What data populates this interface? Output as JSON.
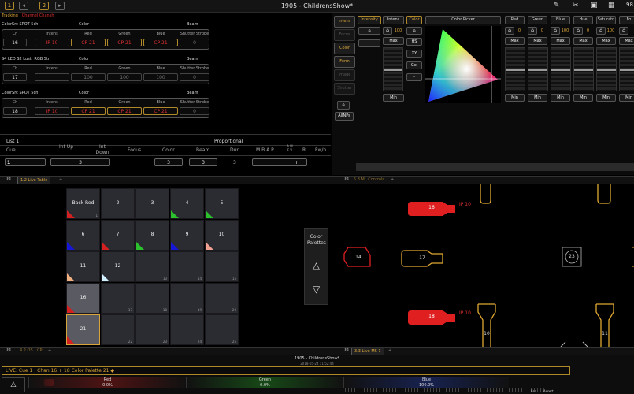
{
  "window": {
    "title": "1905 - ChildrensShow*",
    "tab1": "1",
    "tab2": "2",
    "right_num": "98"
  },
  "channels": {
    "mode": "Tracking",
    "mode_sep": " | ",
    "mode2": "Channel Chansh",
    "groups": [
      {
        "type": "ColorSrc SPOT 5ch",
        "cat_color": "Color",
        "cat_beam": "Beam",
        "headers": [
          "Ch",
          "Intens",
          "Red",
          "Green",
          "Blue",
          "Shutter Strobe"
        ],
        "values": [
          "16",
          "IP 10",
          "CP 21",
          "CP 21",
          "CP 21",
          "0"
        ]
      },
      {
        "type": "S4 LED S2 Lustr RGB Str",
        "cat_color": "Color",
        "cat_beam": "Beam",
        "headers": [
          "Ch",
          "Intens",
          "Red",
          "Green",
          "Blue",
          "Shutter Strobe"
        ],
        "values": [
          "17",
          "",
          "100",
          "100",
          "100",
          "0"
        ]
      },
      {
        "type": "ColorSrc SPOT 5ch",
        "cat_color": "Color",
        "cat_beam": "Beam",
        "headers": [
          "Ch",
          "Intens",
          "Red",
          "Green",
          "Blue",
          "Shutter Strobe"
        ],
        "values": [
          "18",
          "IP 10",
          "CP 21",
          "CP 21",
          "CP 21",
          "0"
        ]
      }
    ]
  },
  "cue": {
    "list": "List 1",
    "proportional": "Proportional",
    "headers": [
      "Cue",
      "Int Up",
      "Int Down",
      "Focus",
      "Color",
      "Beam",
      "Dur",
      "M  B  A  P",
      "A M F V",
      "R",
      "Fw/h"
    ],
    "values": {
      "cue": "1",
      "int_up": "3",
      "focus": "3",
      "color": "3",
      "dur": "3",
      "plus": "+"
    }
  },
  "params": {
    "sidetabs": [
      "Intens",
      "Focus",
      "Color",
      "Form",
      "Image",
      "Shutter"
    ],
    "home_label": "⌂",
    "allnps": "AllNPs",
    "intensity_hdr": "Intensity",
    "intens_hdr": "Intens",
    "color_hdr": "Color",
    "color_picker": "Color Picker",
    "intens_value": "100",
    "max": "Max",
    "min": "Min",
    "color_modes": [
      "HS",
      "XY",
      "Gel"
    ],
    "channels": [
      {
        "name": "Red",
        "value": "0"
      },
      {
        "name": "Green",
        "value": "0"
      },
      {
        "name": "Blue",
        "value": "100"
      },
      {
        "name": "Hue",
        "value": "0"
      },
      {
        "name": "Saturatn",
        "value": "100"
      },
      {
        "name": "Fo",
        "value": ""
      }
    ]
  },
  "tabs": {
    "live_table": "1.2 Live Table",
    "ml_controls": "5.3 ML Controls",
    "plus": "+",
    "bottom_left": "4.2 OS",
    "bottom_left2": "CP",
    "live_ms": "3.3 Live MS 1"
  },
  "palettes": {
    "title": "Color Palettes",
    "cells": [
      {
        "label": "Back Red",
        "num": "1",
        "color": "#d32020"
      },
      {
        "label": "2",
        "num": "",
        "color": ""
      },
      {
        "label": "3",
        "num": "",
        "color": ""
      },
      {
        "label": "4",
        "num": "",
        "color": "#2cc12c"
      },
      {
        "label": "5",
        "num": "",
        "color": "#2cc12c"
      },
      {
        "label": "6",
        "num": "",
        "color": "#1717d6"
      },
      {
        "label": "7",
        "num": "",
        "color": "#d32020"
      },
      {
        "label": "8",
        "num": "",
        "color": "#2cc12c"
      },
      {
        "label": "9",
        "num": "",
        "color": "#1717d6"
      },
      {
        "label": "10",
        "num": "",
        "color": "#f0a090"
      },
      {
        "label": "11",
        "num": "",
        "color": "#f0b080"
      },
      {
        "label": "12",
        "num": "",
        "color": "#d0f0ff"
      },
      {
        "label": "",
        "num": "13",
        "color": ""
      },
      {
        "label": "",
        "num": "14",
        "color": ""
      },
      {
        "label": "",
        "num": "15",
        "color": ""
      },
      {
        "label": "16",
        "num": "",
        "color": "#d32020"
      },
      {
        "label": "",
        "num": "17",
        "color": ""
      },
      {
        "label": "",
        "num": "18",
        "color": ""
      },
      {
        "label": "",
        "num": "19",
        "color": ""
      },
      {
        "label": "",
        "num": "20",
        "color": ""
      },
      {
        "label": "21",
        "num": "",
        "color": "#d32020"
      },
      {
        "label": "",
        "num": "22",
        "color": ""
      },
      {
        "label": "",
        "num": "23",
        "color": ""
      },
      {
        "label": "",
        "num": "24",
        "color": ""
      },
      {
        "label": "",
        "num": "25",
        "color": ""
      }
    ]
  },
  "magic_sheet": {
    "fixtures": [
      {
        "id": "16",
        "label": "IP 10"
      },
      {
        "id": "17",
        "label": ""
      },
      {
        "id": "18",
        "label": "IP 10"
      },
      {
        "id": "14",
        "label": ""
      },
      {
        "id": "23",
        "label": ""
      },
      {
        "id": "10",
        "label": ""
      },
      {
        "id": "11",
        "label": ""
      }
    ]
  },
  "footer": {
    "title": "1905 - ChildrensShow*",
    "datetime": "2018-05-24 11:52:44",
    "command": "LIVE: Cue  1 :  Chan 16 + 18 Color Palette 21 ◆",
    "bars": [
      {
        "name": "Red",
        "value": "0.0%",
        "color": "#d32020"
      },
      {
        "name": "Green",
        "value": "0.0%",
        "color": "#2cc12c"
      },
      {
        "name": "Blue",
        "value": "100.0%",
        "color": "#2c4cd6"
      }
    ],
    "btn_labels": [
      "Esc",
      "Assert"
    ]
  }
}
